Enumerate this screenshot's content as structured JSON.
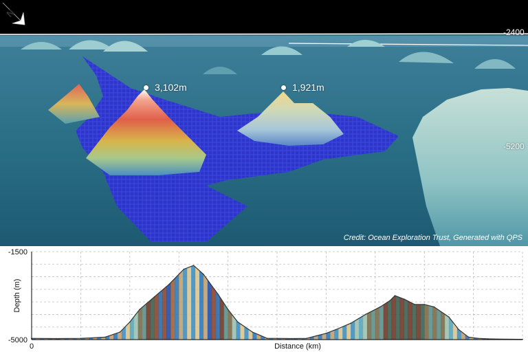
{
  "scene": {
    "peaks": [
      {
        "label": "3,102m"
      },
      {
        "label": "1,921m"
      }
    ],
    "depth_ticks": [
      "-2400",
      "-5200"
    ],
    "credit": "Credit: Ocean Exploration Trust, Generated with QPS",
    "north_label": "N"
  },
  "colors": {
    "seafloor": "#2a6f86",
    "multibeam": "#2f2fd0",
    "peak_high": "#f08a6a",
    "sky": "#000000"
  },
  "chart_data": {
    "type": "area",
    "title": "",
    "xlabel": "Distance (km)",
    "ylabel": "Depth (m)",
    "ylim": [
      -5000,
      -1500
    ],
    "y_ticks": [
      "-1500",
      "-5000"
    ],
    "x_ticks": [
      "0"
    ],
    "grid": true,
    "x": [
      0,
      0.05,
      0.1,
      0.15,
      0.18,
      0.2,
      0.22,
      0.25,
      0.28,
      0.31,
      0.33,
      0.35,
      0.38,
      0.4,
      0.42,
      0.45,
      0.48,
      0.5,
      0.53,
      0.56,
      0.58,
      0.6,
      0.62,
      0.65,
      0.68,
      0.71,
      0.73,
      0.74,
      0.76,
      0.78,
      0.8,
      0.82,
      0.85,
      0.87,
      0.89,
      0.91,
      0.93,
      0.95,
      1.0
    ],
    "y": [
      -4950,
      -4960,
      -4950,
      -4900,
      -4700,
      -4300,
      -3800,
      -3300,
      -2800,
      -2200,
      -2050,
      -2400,
      -3200,
      -3800,
      -4300,
      -4700,
      -4950,
      -4950,
      -4960,
      -4950,
      -4850,
      -4750,
      -4600,
      -4350,
      -4000,
      -3700,
      -3450,
      -3250,
      -3400,
      -3600,
      -3600,
      -3700,
      -4100,
      -4600,
      -4900,
      -4950,
      -4970,
      -4980,
      -4990
    ]
  }
}
